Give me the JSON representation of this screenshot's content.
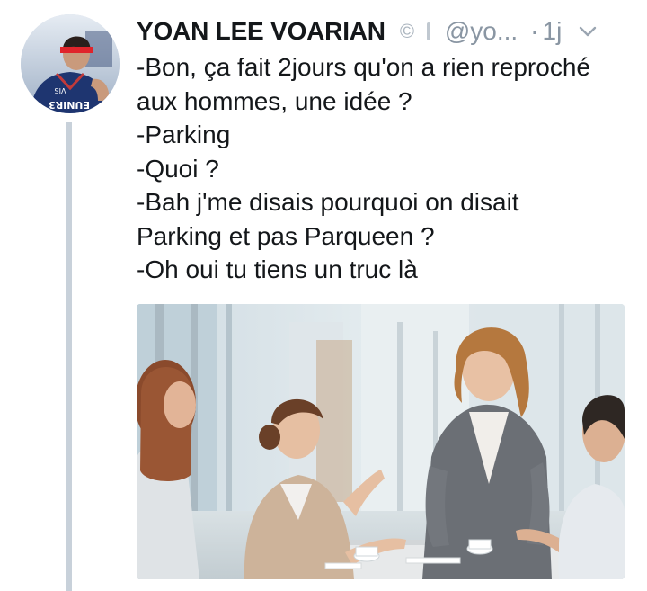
{
  "author": {
    "display_name": "YOAN LEE VOARIAN",
    "handle": "@yo...",
    "separator": "·",
    "time_ago": "1j",
    "avatar_jersey_text": "EUNIR3",
    "avatar_jersey_number": "VIS"
  },
  "icons": {
    "badge_1": "copyright-badge-icon",
    "badge_2": "bar-badge-icon",
    "menu": "chevron-down-icon",
    "badge_1_glyph": "©"
  },
  "tweet": {
    "lines": [
      "-Bon, ça fait 2jours qu'on a rien reproché",
      "aux hommes, une idée ?",
      "-Parking",
      "-Quoi ?",
      "-Bah j'me disais pourquoi on disait",
      "Parking et pas Parqueen ?",
      "-Oh oui tu tiens un truc là"
    ]
  },
  "colors": {
    "text": "#14171a",
    "muted": "#8a96a3",
    "thread_line": "#c8d1da"
  }
}
